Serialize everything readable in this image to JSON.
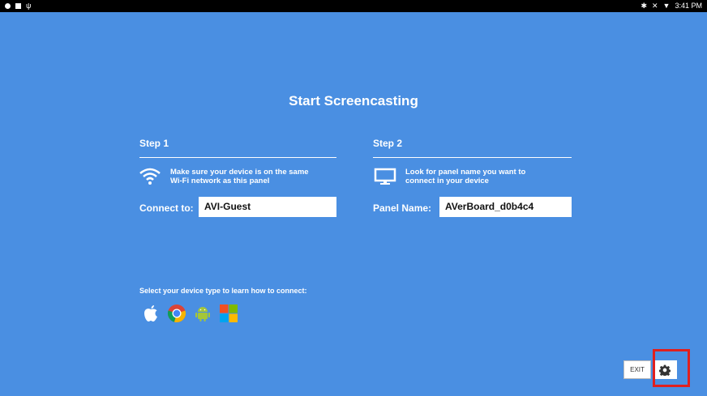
{
  "status": {
    "time": "3:41 PM"
  },
  "main": {
    "title": "Start Screencasting"
  },
  "step1": {
    "title": "Step 1",
    "desc_line1": "Make sure your device is on the same",
    "desc_line2": "Wi-Fi network as this panel",
    "connect_label": "Connect to:",
    "connect_value": "AVI-Guest",
    "icon": "wifi-icon"
  },
  "step2": {
    "title": "Step 2",
    "desc_line1": "Look for panel name you want to",
    "desc_line2": "connect in your device",
    "panel_label": "Panel Name:",
    "panel_value": "AVerBoard_d0b4c4",
    "icon": "monitor-icon"
  },
  "device_select": {
    "prompt": "Select your device type to learn how to connect:",
    "devices": [
      "apple-icon",
      "chrome-icon",
      "android-icon",
      "windows-icon"
    ]
  },
  "controls": {
    "exit_label": "EXIT"
  },
  "colors": {
    "background": "#4a8fe2",
    "highlight": "#e0201f"
  }
}
